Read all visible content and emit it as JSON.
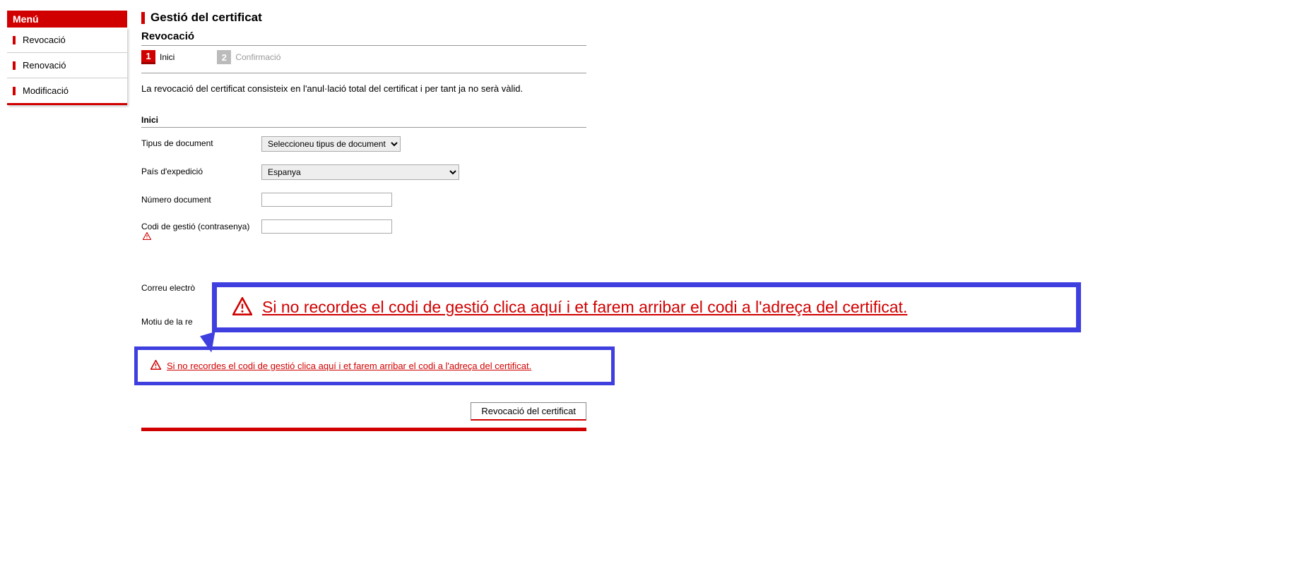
{
  "menu": {
    "header": "Menú",
    "items": [
      {
        "label": "Revocació"
      },
      {
        "label": "Renovació"
      },
      {
        "label": "Modificació"
      }
    ]
  },
  "page": {
    "title": "Gestió del certificat",
    "subtitle": "Revocació"
  },
  "steps": [
    {
      "num": "1",
      "label": "Inici",
      "active": true
    },
    {
      "num": "2",
      "label": "Confirmació",
      "active": false
    }
  ],
  "description": "La revocació del certificat consisteix en l'anul·lació total del certificat i per tant ja no serà vàlid.",
  "form": {
    "section_title": "Inici",
    "doc_type_label": "Tipus de document",
    "doc_type_selected": "Seleccioneu tipus de document",
    "country_label": "País d'expedició",
    "country_selected": "Espanya",
    "doc_number_label": "Número document",
    "doc_number_value": "",
    "mgmt_code_label": "Codi de gestió (contrasenya)",
    "mgmt_code_value": "",
    "email_label_partial": "Correu electrò",
    "motiu_label_partial": "Motiu de la re"
  },
  "callout": {
    "text": "Si no recordes el codi de gestió clica aquí i et farem arribar el codi a l'adreça del certificat."
  },
  "submit": {
    "button_label": "Revocació del certificat"
  }
}
